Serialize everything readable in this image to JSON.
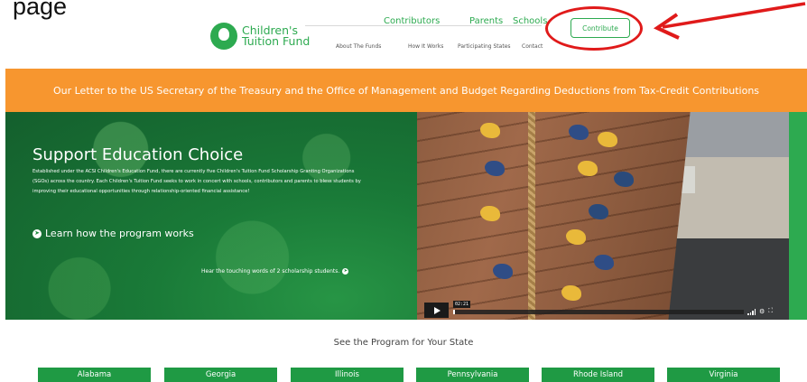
{
  "caption": "page",
  "header": {
    "logo_line1": "Children's",
    "logo_line2": "Tuition Fund",
    "top_nav": [
      "Contributors",
      "Parents",
      "Schools"
    ],
    "sub_nav": [
      "About The Funds",
      "How It Works",
      "Participating States",
      "Contact"
    ],
    "contribute_label": "Contribute"
  },
  "banner": {
    "text": "Our Letter to the US Secretary of the Treasury and the Office of Management and Budget Regarding Deductions from Tax-Credit Contributions",
    "color": "#f7962f"
  },
  "hero": {
    "title": "Support Education Choice",
    "description": "Established under the ACSI Children's Education Fund, there are currently five Children's Tuition Fund Scholarship Granting Organizations (SGOs) across the country. Each Children's Tuition Fund seeks to work in concert with schools, contributors and parents to bless students by improving their educational opportunities through relationship-oriented financial assistance!",
    "link_label": "Learn how the program works",
    "sub_link": "Hear the touching words of 2 scholarship students.",
    "video": {
      "timecode": "02:21",
      "progress": 0.0
    }
  },
  "states": {
    "title": "See the Program for Your State",
    "items": [
      "Alabama",
      "Georgia",
      "Illinois",
      "Pennsylvania",
      "Rhode Island",
      "Virginia"
    ]
  },
  "colors": {
    "brand_green": "#2daa50",
    "annotation_red": "#e01a1a"
  }
}
